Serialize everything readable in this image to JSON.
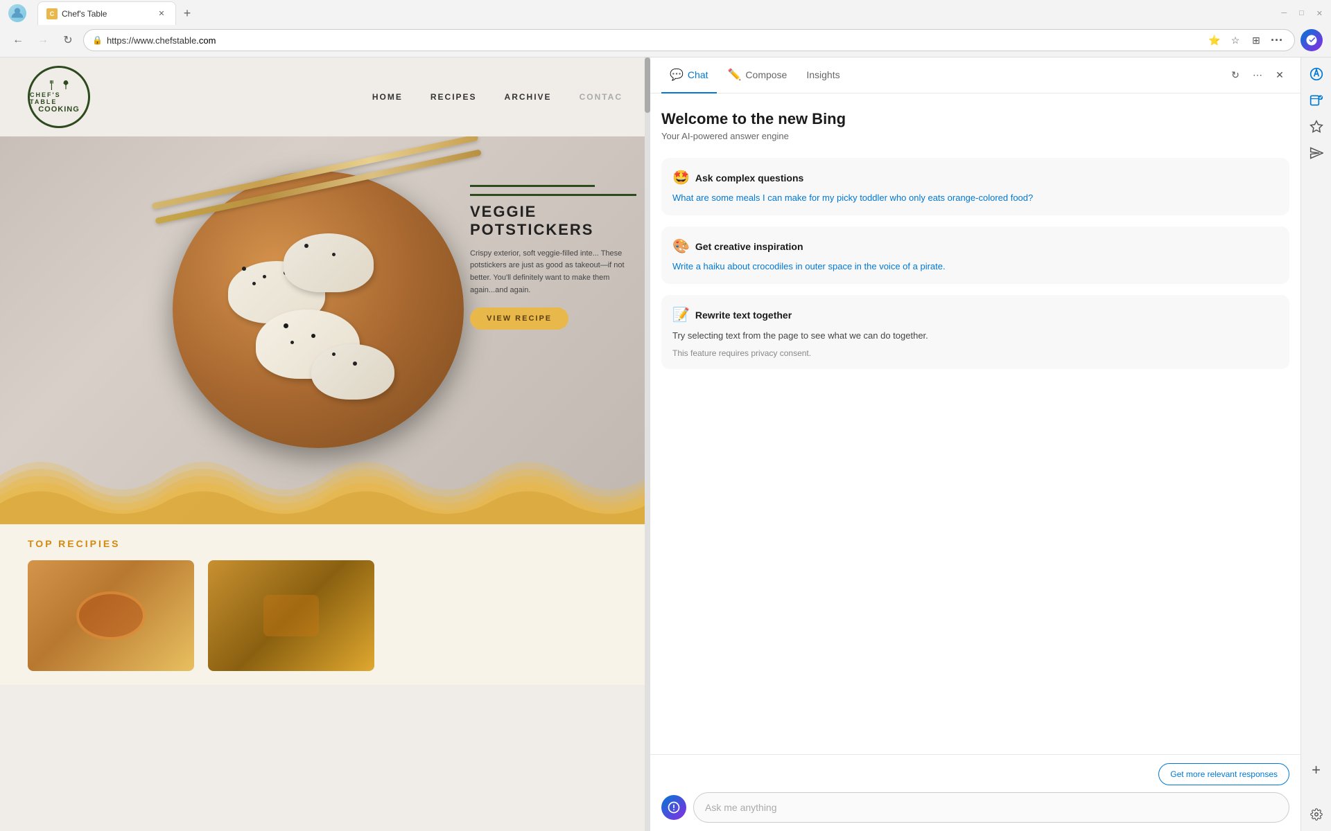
{
  "browser": {
    "tab_title": "Chef's Table",
    "tab_favicon": "C",
    "url_prefix": "https://www.chefstable",
    "url_domain": ".com",
    "url_full": "https://www.chefstable.com/",
    "nav_back_label": "Back",
    "nav_forward_label": "Forward",
    "nav_refresh_label": "Refresh",
    "new_tab_label": "New tab",
    "window_min": "Minimize",
    "window_max": "Maximize",
    "window_close": "Close"
  },
  "site": {
    "logo_text_top": "CHEF'S TABLE",
    "logo_text_middle": "◆ ◆",
    "logo_text_bottom": "COOKING",
    "nav_items": [
      "HOME",
      "RECIPES",
      "ARCHIVE",
      "CONTACT"
    ],
    "hero_title": "VEGGIE\nPOTSTICKERS",
    "hero_description": "Crispy exterior, soft veggie-filled interior. These potstickers are just as good as takeout—if not better. You'll definitely want to make them again...and again.",
    "view_recipe_btn": "VIEW RECIPE",
    "top_recipes_label": "TOP RECIPIES"
  },
  "bing": {
    "panel_title": "Bing",
    "tab_chat": "Chat",
    "tab_compose": "Compose",
    "tab_insights": "Insights",
    "welcome_title": "Welcome to the new Bing",
    "welcome_subtitle": "Your AI-powered answer engine",
    "card1": {
      "emoji": "🤩",
      "title": "Ask complex questions",
      "link": "What are some meals I can make for my picky toddler who only eats orange-colored food?"
    },
    "card2": {
      "emoji": "🎨",
      "title": "Get creative inspiration",
      "link": "Write a haiku about crocodiles in outer space in the voice of a pirate."
    },
    "card3": {
      "emoji": "📝",
      "title": "Rewrite text together",
      "text": "Try selecting text from the page to see what we can do together.",
      "subtext": "This feature requires privacy consent."
    },
    "get_more_btn": "Get more relevant responses",
    "ask_placeholder": "Ask me anything",
    "refresh_tooltip": "Refresh",
    "more_tooltip": "More",
    "close_tooltip": "Close"
  },
  "edge_icons": {
    "collections": "Collections",
    "outlook": "Outlook",
    "bing_icon": "Bing",
    "send": "Send",
    "add": "Add",
    "settings": "Settings"
  }
}
